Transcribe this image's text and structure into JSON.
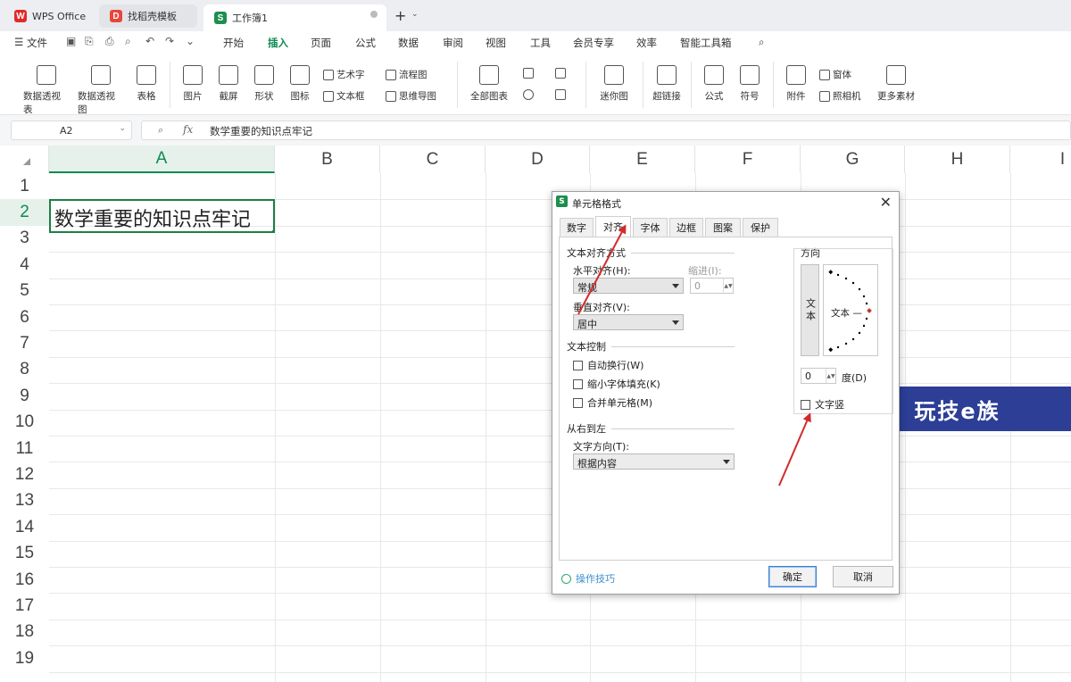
{
  "tabs": {
    "wps": "WPS Office",
    "template": "找稻壳模板",
    "doc": "工作簿1"
  },
  "menu": {
    "file": "文件",
    "items": [
      "开始",
      "插入",
      "页面",
      "公式",
      "数据",
      "审阅",
      "视图",
      "工具",
      "会员专享",
      "效率",
      "智能工具箱"
    ],
    "active": "插入"
  },
  "ribbon": {
    "pivot_table": "数据透视表",
    "pivot_chart": "数据透视图",
    "table": "表格",
    "picture": "图片",
    "screenshot": "截屏",
    "shape": "形状",
    "icon": "图标",
    "art_text": "艺术字",
    "text_box": "文本框",
    "flowchart": "流程图",
    "mindmap": "思维导图",
    "all_charts": "全部图表",
    "sparkline": "迷你图",
    "hyperlink": "超链接",
    "formula": "公式",
    "symbol": "符号",
    "attachment": "附件",
    "window": "窗体",
    "camera": "照相机",
    "more": "更多素材"
  },
  "formula_bar": {
    "cell_ref": "A2",
    "fx": "fx",
    "content": "数学重要的知识点牢记"
  },
  "columns": [
    "A",
    "B",
    "C",
    "D",
    "E",
    "F",
    "G",
    "H",
    "I"
  ],
  "rows": [
    "1",
    "2",
    "3",
    "4",
    "5",
    "6",
    "7",
    "8",
    "9",
    "10",
    "11",
    "12",
    "13",
    "14",
    "15",
    "16",
    "17",
    "18",
    "19"
  ],
  "cell_a2": "数学重要的知识点牢记",
  "dialog": {
    "title": "单元格格式",
    "tabs": [
      "数字",
      "对齐",
      "字体",
      "边框",
      "图案",
      "保护"
    ],
    "active_tab": "对齐",
    "text_align_group": "文本对齐方式",
    "horizontal_label": "水平对齐(H):",
    "horizontal_value": "常规",
    "indent_label": "缩进(I):",
    "indent_value": "0",
    "vertical_label": "垂直对齐(V):",
    "vertical_value": "居中",
    "text_control_group": "文本控制",
    "wrap": "自动换行(W)",
    "shrink": "缩小字体填充(K)",
    "merge": "合并单元格(M)",
    "rtl_group": "从右到左",
    "direction_label": "文字方向(T):",
    "direction_value": "根据内容",
    "orientation_group": "方向",
    "vertical_text_button": "文本",
    "dial_text": "文本 —",
    "degree_value": "0",
    "degree_label": "度(D)",
    "vertical_text_check": "文字竖",
    "tips": "操作技巧",
    "ok": "确定",
    "cancel": "取消"
  },
  "watermark": "玩技e族",
  "colors": {
    "accent": "#0e8a52",
    "arrow": "#d22b2b",
    "watermark_bg": "#2c3e96"
  }
}
